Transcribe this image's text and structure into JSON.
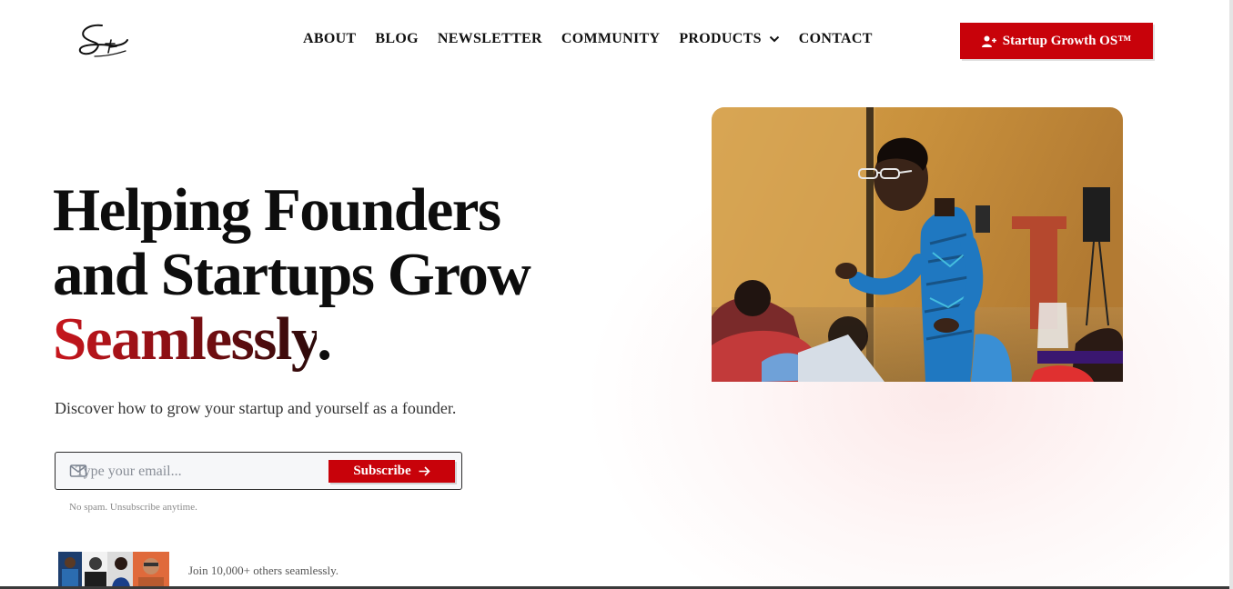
{
  "brand": {
    "logo_icon": "signature-logo-icon"
  },
  "nav": {
    "items": [
      {
        "label": "ABOUT"
      },
      {
        "label": "BLOG"
      },
      {
        "label": "NEWSLETTER"
      },
      {
        "label": "COMMUNITY"
      },
      {
        "label": "PRODUCTS",
        "has_dropdown": true
      },
      {
        "label": "CONTACT"
      }
    ]
  },
  "header_cta": {
    "label": "Startup Growth OS™",
    "icon": "user-plus-icon"
  },
  "hero": {
    "title_line1": "Helping Founders",
    "title_line2": "and Startups Grow",
    "title_accent": "Seamlessly",
    "title_period": ".",
    "subtitle": "Discover how to grow your startup and yourself as a founder."
  },
  "subscribe": {
    "placeholder": "Type your email...",
    "button_label": "Subscribe",
    "note": "No spam. Unsubscribe anytime."
  },
  "social_proof": {
    "text": "Join 10,000+ others seamlessly."
  },
  "colors": {
    "accent": "#c8020a",
    "accent_dark": "#8b0f14",
    "text": "#0d0d0d"
  }
}
